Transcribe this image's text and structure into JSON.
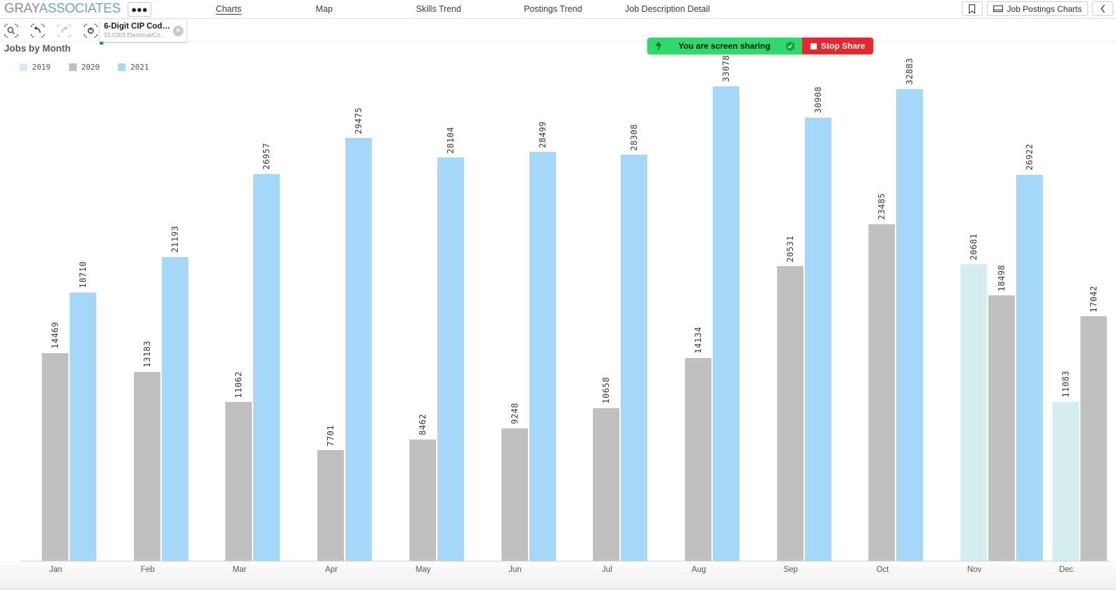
{
  "header": {
    "brand_first": "GRAY",
    "brand_second": "ASSOCIATES",
    "menu_icon": "more-dots-icon",
    "tabs": [
      {
        "label": "Charts",
        "active": true
      },
      {
        "label": "Map",
        "active": false
      },
      {
        "label": "Skills Trend",
        "active": false
      },
      {
        "label": "Postings Trend",
        "active": false
      },
      {
        "label": "Job Description Detail",
        "active": false
      }
    ],
    "right": {
      "bookmark_icon": "bookmark-icon",
      "workbook_icon": "presentation-icon",
      "workbook_label": "Job Postings Charts",
      "collapse_icon": "chevron-left-icon"
    }
  },
  "toolbar": {
    "icons": [
      {
        "name": "zoom-search-icon",
        "disabled": false
      },
      {
        "name": "undo-arrow-icon",
        "disabled": false
      },
      {
        "name": "redo-arrow-icon",
        "disabled": true
      },
      {
        "name": "reset-icon",
        "disabled": false
      }
    ],
    "filter_chip": {
      "title": "6-Digit CIP Cod…",
      "subtitle": "15.0303 Electrical/Co…",
      "close_icon": "close-circle-icon",
      "close_glyph": "✕"
    }
  },
  "share_banner": {
    "arrow_icon": "share-arrow-icon",
    "text": "You are screen sharing",
    "shield_icon": "shield-check-icon",
    "stop_label": "Stop Share",
    "stop_icon": "stop-square-icon",
    "green": "#2fd96a",
    "red": "#e8262d"
  },
  "chart_data": {
    "type": "bar",
    "title": "Jobs by Month",
    "xlabel": "",
    "ylabel": "",
    "grid": false,
    "legend_position": "top-left",
    "ylim": [
      0,
      34000
    ],
    "categories": [
      "Jan",
      "Feb",
      "Mar",
      "Apr",
      "May",
      "Jun",
      "Jul",
      "Aug",
      "Sep",
      "Oct",
      "Nov",
      "Dec"
    ],
    "series": [
      {
        "name": "2019",
        "color": "#d4eef0",
        "values": [
          null,
          null,
          null,
          null,
          null,
          null,
          null,
          null,
          null,
          null,
          20681,
          11083
        ]
      },
      {
        "name": "2020",
        "color": "#c0c0c0",
        "values": [
          14469,
          13183,
          11062,
          7701,
          8462,
          9248,
          10658,
          14134,
          20531,
          23485,
          18498,
          17042
        ]
      },
      {
        "name": "2021",
        "color": "#a5d8f8",
        "values": [
          18710,
          21193,
          26957,
          29475,
          28104,
          28499,
          28308,
          33078,
          30908,
          32883,
          26922,
          null
        ]
      }
    ]
  }
}
